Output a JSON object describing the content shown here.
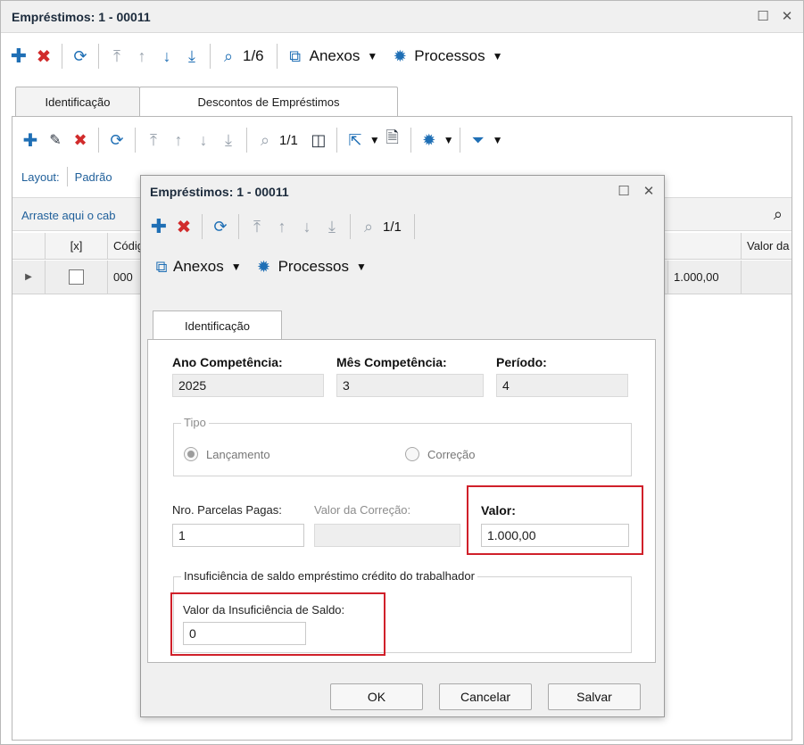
{
  "window": {
    "title": "Empréstimos: 1 - 00011",
    "toolbar": {
      "record_counter": "1/6",
      "attachments_label": "Anexos",
      "processes_label": "Processos"
    },
    "tabs": [
      {
        "label": "Identificação"
      },
      {
        "label": "Descontos de Empréstimos"
      }
    ]
  },
  "inner": {
    "toolbar": {
      "record_counter": "1/1"
    },
    "layout_label": "Layout:",
    "layout_value": "Padrão",
    "group_hint": "Arraste aqui o cab",
    "columns": {
      "select": "[x]",
      "code": "Códig",
      "value": "Valor da"
    },
    "rows": [
      {
        "code": "000",
        "amount": "1.000,00"
      }
    ]
  },
  "modal": {
    "title": "Empréstimos: 1 - 00011",
    "toolbar": {
      "record_counter": "1/1",
      "attachments_label": "Anexos",
      "processes_label": "Processos"
    },
    "tab_label": "Identificação",
    "fields": {
      "ano_label": "Ano Competência:",
      "ano_value": "2025",
      "mes_label": "Mês Competência:",
      "mes_value": "3",
      "periodo_label": "Período:",
      "periodo_value": "4",
      "tipo_legend": "Tipo",
      "radio_lancamento": "Lançamento",
      "radio_correcao": "Correção",
      "parcelas_label": "Nro. Parcelas Pagas:",
      "parcelas_value": "1",
      "valor_correcao_label": "Valor da Correção:",
      "valor_correcao_value": "",
      "valor_label": "Valor:",
      "valor_value": "1.000,00",
      "insuf_legend": "Insuficiência de saldo empréstimo crédito do trabalhador",
      "insuf_label": "Valor da Insuficiência de Saldo:",
      "insuf_value": "0"
    },
    "buttons": {
      "ok": "OK",
      "cancel": "Cancelar",
      "save": "Salvar"
    }
  },
  "colors": {
    "accent": "#1f6fb5",
    "delete": "#d12b2b",
    "highlight": "#d0202a"
  }
}
